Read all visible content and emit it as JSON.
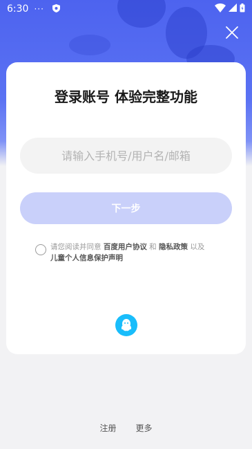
{
  "status_bar": {
    "time": "6:30",
    "dots": "···"
  },
  "card": {
    "title": "登录账号 体验完整功能",
    "input_placeholder": "请输入手机号/用户名/邮箱",
    "next_label": "下一步",
    "agreement": {
      "prefix": "请您阅读并同意 ",
      "link1": "百度用户协议",
      "and": " 和 ",
      "link2": "隐私政策",
      "middle": " 以及 ",
      "link3": "儿童个人信息保护声明"
    }
  },
  "footer": {
    "register": "注册",
    "more": "更多"
  },
  "colors": {
    "accent": "#4d63ef",
    "button_disabled": "#c9d0fa",
    "qq": "#19bdfb"
  },
  "icons": [
    "close-icon",
    "wifi-icon",
    "signal-icon",
    "battery-icon",
    "shield-icon",
    "qq-icon"
  ]
}
